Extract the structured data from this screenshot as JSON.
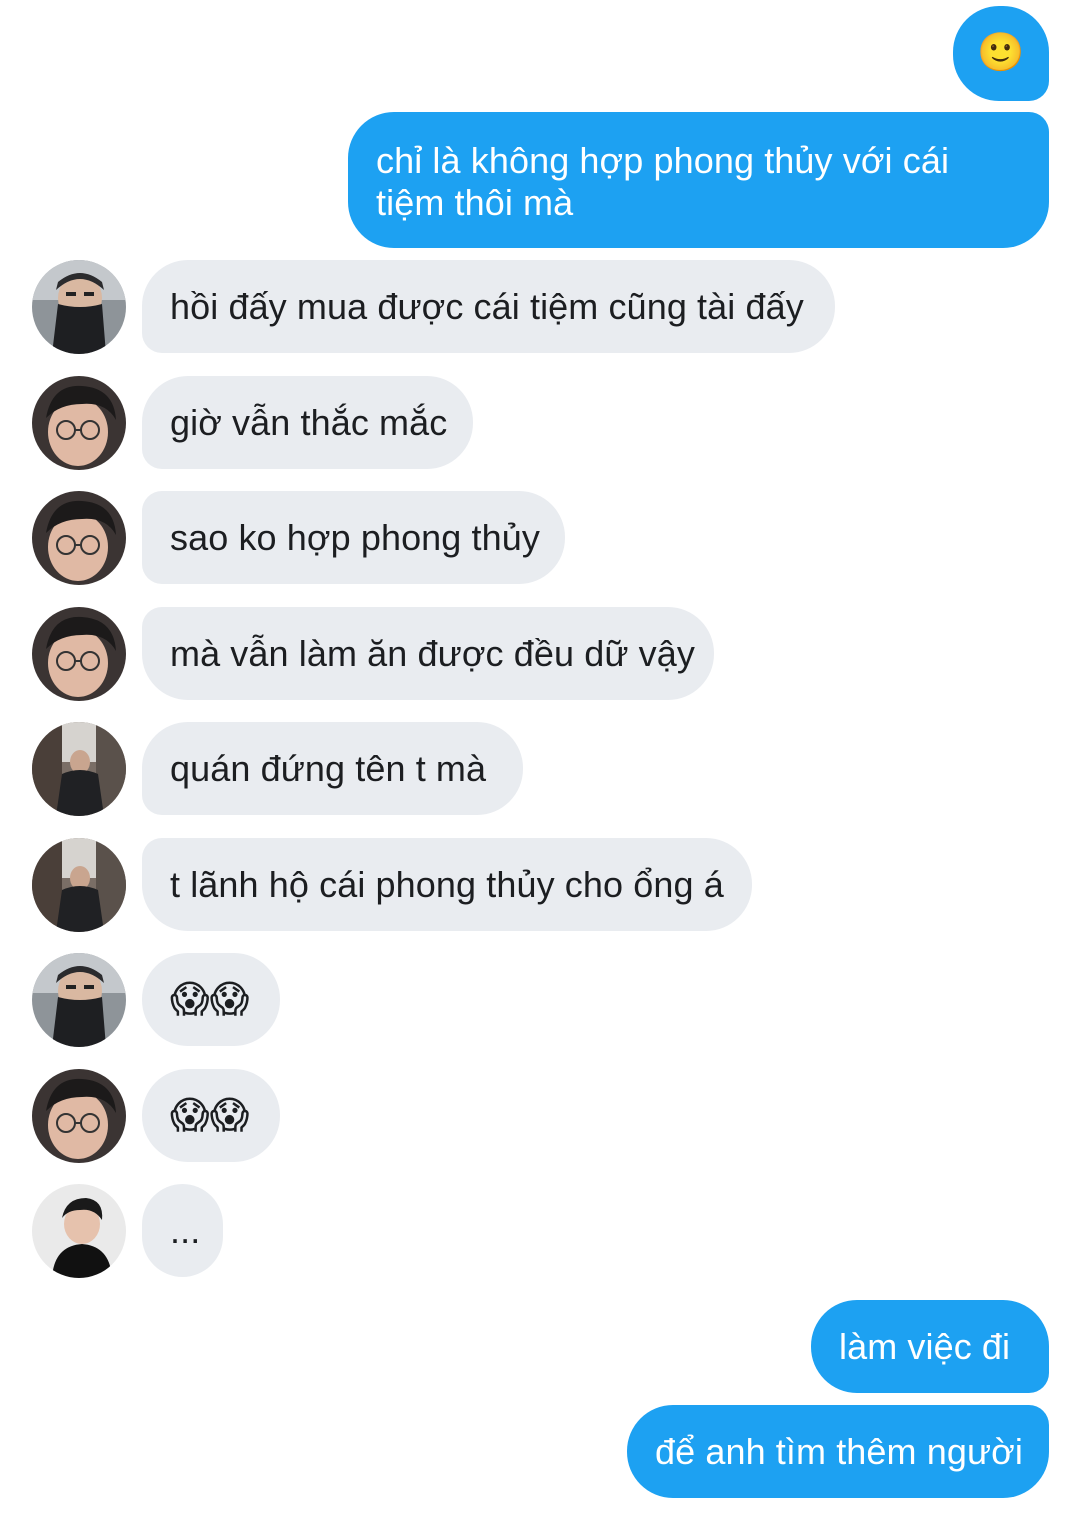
{
  "messages": [
    {
      "side": "out",
      "text": "🙂"
    },
    {
      "side": "out",
      "text": "chỉ là không hợp phong thủy với cái tiệm thôi mà"
    },
    {
      "side": "in",
      "avatar": "avatar-masked-person",
      "text": "hồi đấy mua được cái tiệm cũng tài đấy"
    },
    {
      "side": "in",
      "avatar": "avatar-glasses-person",
      "text": "giờ vẫn thắc mắc"
    },
    {
      "side": "in",
      "avatar": "avatar-glasses-person",
      "text": "sao ko hợp phong thủy"
    },
    {
      "side": "in",
      "avatar": "avatar-glasses-person",
      "text": "mà vẫn làm ăn được đều dữ vậy"
    },
    {
      "side": "in",
      "avatar": "avatar-street-person",
      "text": "quán đứng tên t mà"
    },
    {
      "side": "in",
      "avatar": "avatar-street-person",
      "text": "t lãnh hộ cái phong thủy cho ổng á"
    },
    {
      "side": "in",
      "avatar": "avatar-masked-person",
      "text": "😱😱"
    },
    {
      "side": "in",
      "avatar": "avatar-glasses-person",
      "text": "😱😱"
    },
    {
      "side": "in",
      "avatar": "avatar-studio-person",
      "text": "..."
    },
    {
      "side": "out",
      "text": "làm việc đi"
    },
    {
      "side": "out",
      "text": "để anh tìm thêm người"
    }
  ],
  "colors": {
    "outgoing_bubble": "#1da1f2",
    "incoming_bubble": "#e9ecf0",
    "text_dark": "#1c1e21",
    "background": "#ffffff"
  }
}
